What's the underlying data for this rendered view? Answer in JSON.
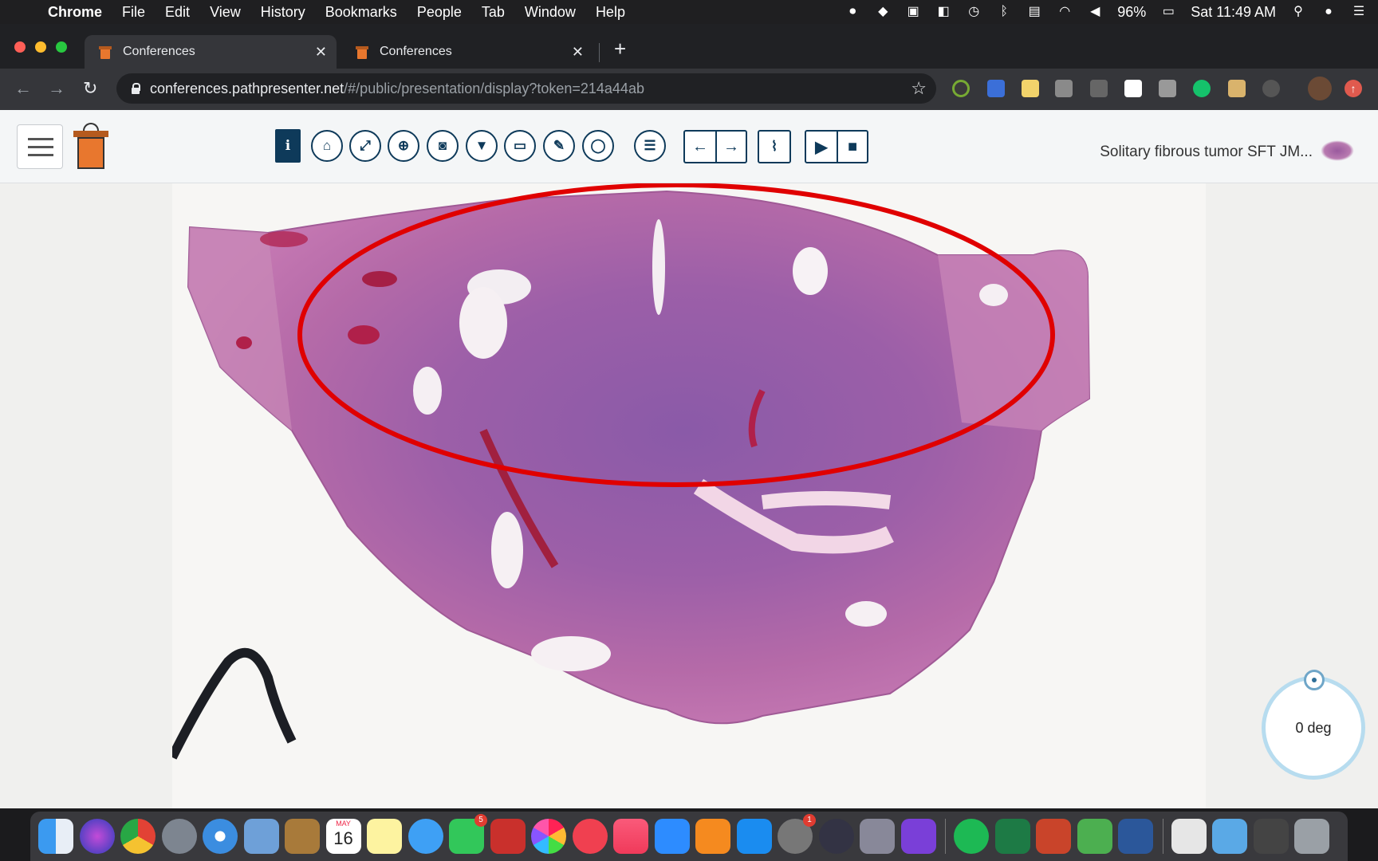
{
  "menubar": {
    "app_name": "Chrome",
    "items": [
      "File",
      "Edit",
      "View",
      "History",
      "Bookmarks",
      "People",
      "Tab",
      "Window",
      "Help"
    ],
    "battery": "96%",
    "clock": "Sat 11:49 AM"
  },
  "browser": {
    "tabs": [
      {
        "title": "Conferences",
        "active": true
      },
      {
        "title": "Conferences",
        "active": false
      }
    ],
    "url_host": "conferences.pathpresenter.net",
    "url_path": "/#/public/presentation/display?token=214a44ab"
  },
  "app": {
    "toolbar_buttons": [
      "info-icon",
      "home-icon",
      "expand-icon",
      "zoom-icon",
      "camera-icon",
      "filter-icon",
      "monitor-icon",
      "pencil-icon",
      "lasso-icon",
      "list-icon",
      "arrow-left-icon",
      "arrow-right-icon",
      "paperclip-icon",
      "video-camera-icon",
      "stop-icon"
    ],
    "slide_title": "Solitary fibrous tumor SFT JM...",
    "rotation_label": "0 deg"
  },
  "annotation": {
    "shape": "ellipse",
    "color": "#e00000"
  },
  "dock": {
    "facetime_badge": "5",
    "calendar_month": "MAY",
    "calendar_day": "16",
    "settings_badge": "1"
  }
}
